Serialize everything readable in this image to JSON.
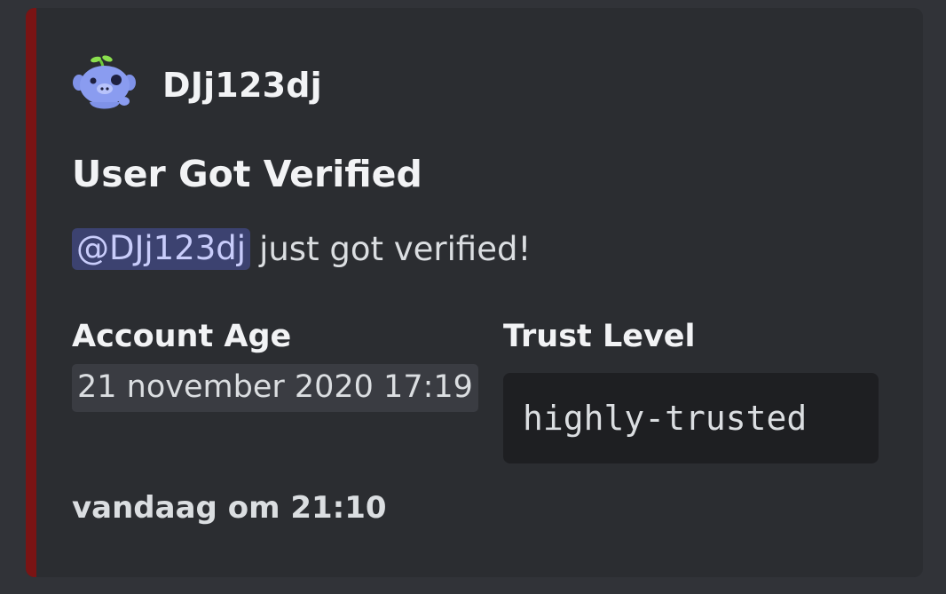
{
  "embed": {
    "accent_color": "#7a1414",
    "author": {
      "name": "DJj123dj",
      "avatar_icon": "clyde-avatar-icon"
    },
    "title": "User Got Verified",
    "description": {
      "mention": "@DJj123dj",
      "text": "just got verified!"
    },
    "fields": [
      {
        "name": "Account Age",
        "value": "21 november 2020 17:19"
      },
      {
        "name": "Trust Level",
        "value": "highly-trusted"
      }
    ],
    "footer": {
      "timestamp": "vandaag om 21:10"
    }
  }
}
